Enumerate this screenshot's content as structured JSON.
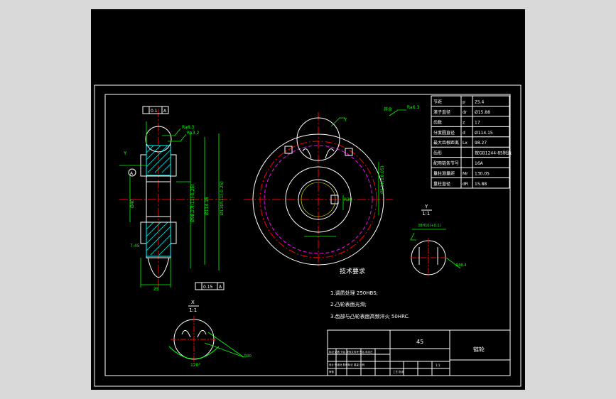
{
  "params_table": {
    "rows": [
      {
        "name": "节距",
        "symbol": "p",
        "value": "25.4"
      },
      {
        "name": "滚子直径",
        "symbol": "dr",
        "value": "Ø15.88"
      },
      {
        "name": "齿数",
        "symbol": "z",
        "value": "17"
      },
      {
        "name": "分度圆直径",
        "symbol": "d",
        "value": "Ø114.15"
      },
      {
        "name": "最大齿根距离",
        "symbol": "Lx",
        "value": "98.27"
      },
      {
        "name": "齿形",
        "symbol": "",
        "value": "按GB1244-85制造"
      },
      {
        "name": "配用链条节号",
        "symbol": "",
        "value": "16A"
      },
      {
        "name": "量柱测量距",
        "symbol": "Mr",
        "value": "130.05"
      },
      {
        "name": "量柱直径",
        "symbol": "dR",
        "value": "15.88"
      }
    ]
  },
  "tech_requirements": {
    "title": "技术要求",
    "items": [
      "1.调质处理 250HBS;",
      "2.凸轮表面光滑;",
      "3.齿部与凸轮表面高频淬火 50HRC."
    ]
  },
  "views": {
    "detail_y_label": "Y",
    "detail_y_scale": "1:1",
    "detail_x_label": "X",
    "detail_x_scale": "1:1",
    "angle_120": "120°",
    "marker_y": "Y",
    "marker_x": "X",
    "marker_a": "A"
  },
  "annotations": {
    "roughness_top": "Ra6.3",
    "roughness_mid": "Ra3.2",
    "roughness_other": "其余",
    "tolerance_top": "0.1",
    "tolerance_bottom": "0.15",
    "datum": "A",
    "dim_25": "25",
    "dim_phi_114": "Ø114.15",
    "dim_phi_130": "Ø130h11(-0.25)",
    "dim_phi_98": "Ø98.27h11(-0.25)",
    "dim_phi_40": "Ø40",
    "dim_r_right": "Ø134(±0.05)",
    "dim_detail_y": "38H10(+0.1)",
    "dim_r84": "R98.4",
    "dim_r_small": "R30",
    "dim_hub": "7-45"
  },
  "title_block": {
    "material": "45",
    "part_name": "链轮",
    "rows": [
      "标记 处数 分区 更改文件号 签名 年月日",
      "设计  标准化  阶段标记 重量 比例",
      "审核",
      "工艺  批准"
    ],
    "scale_value": "1:1"
  },
  "colors": {
    "background": "#000000",
    "outline": "#ffffff",
    "dimension": "#00ff00",
    "center_line": "#ff0000",
    "hatch": "#00ffff",
    "magenta": "#ff00ff"
  }
}
